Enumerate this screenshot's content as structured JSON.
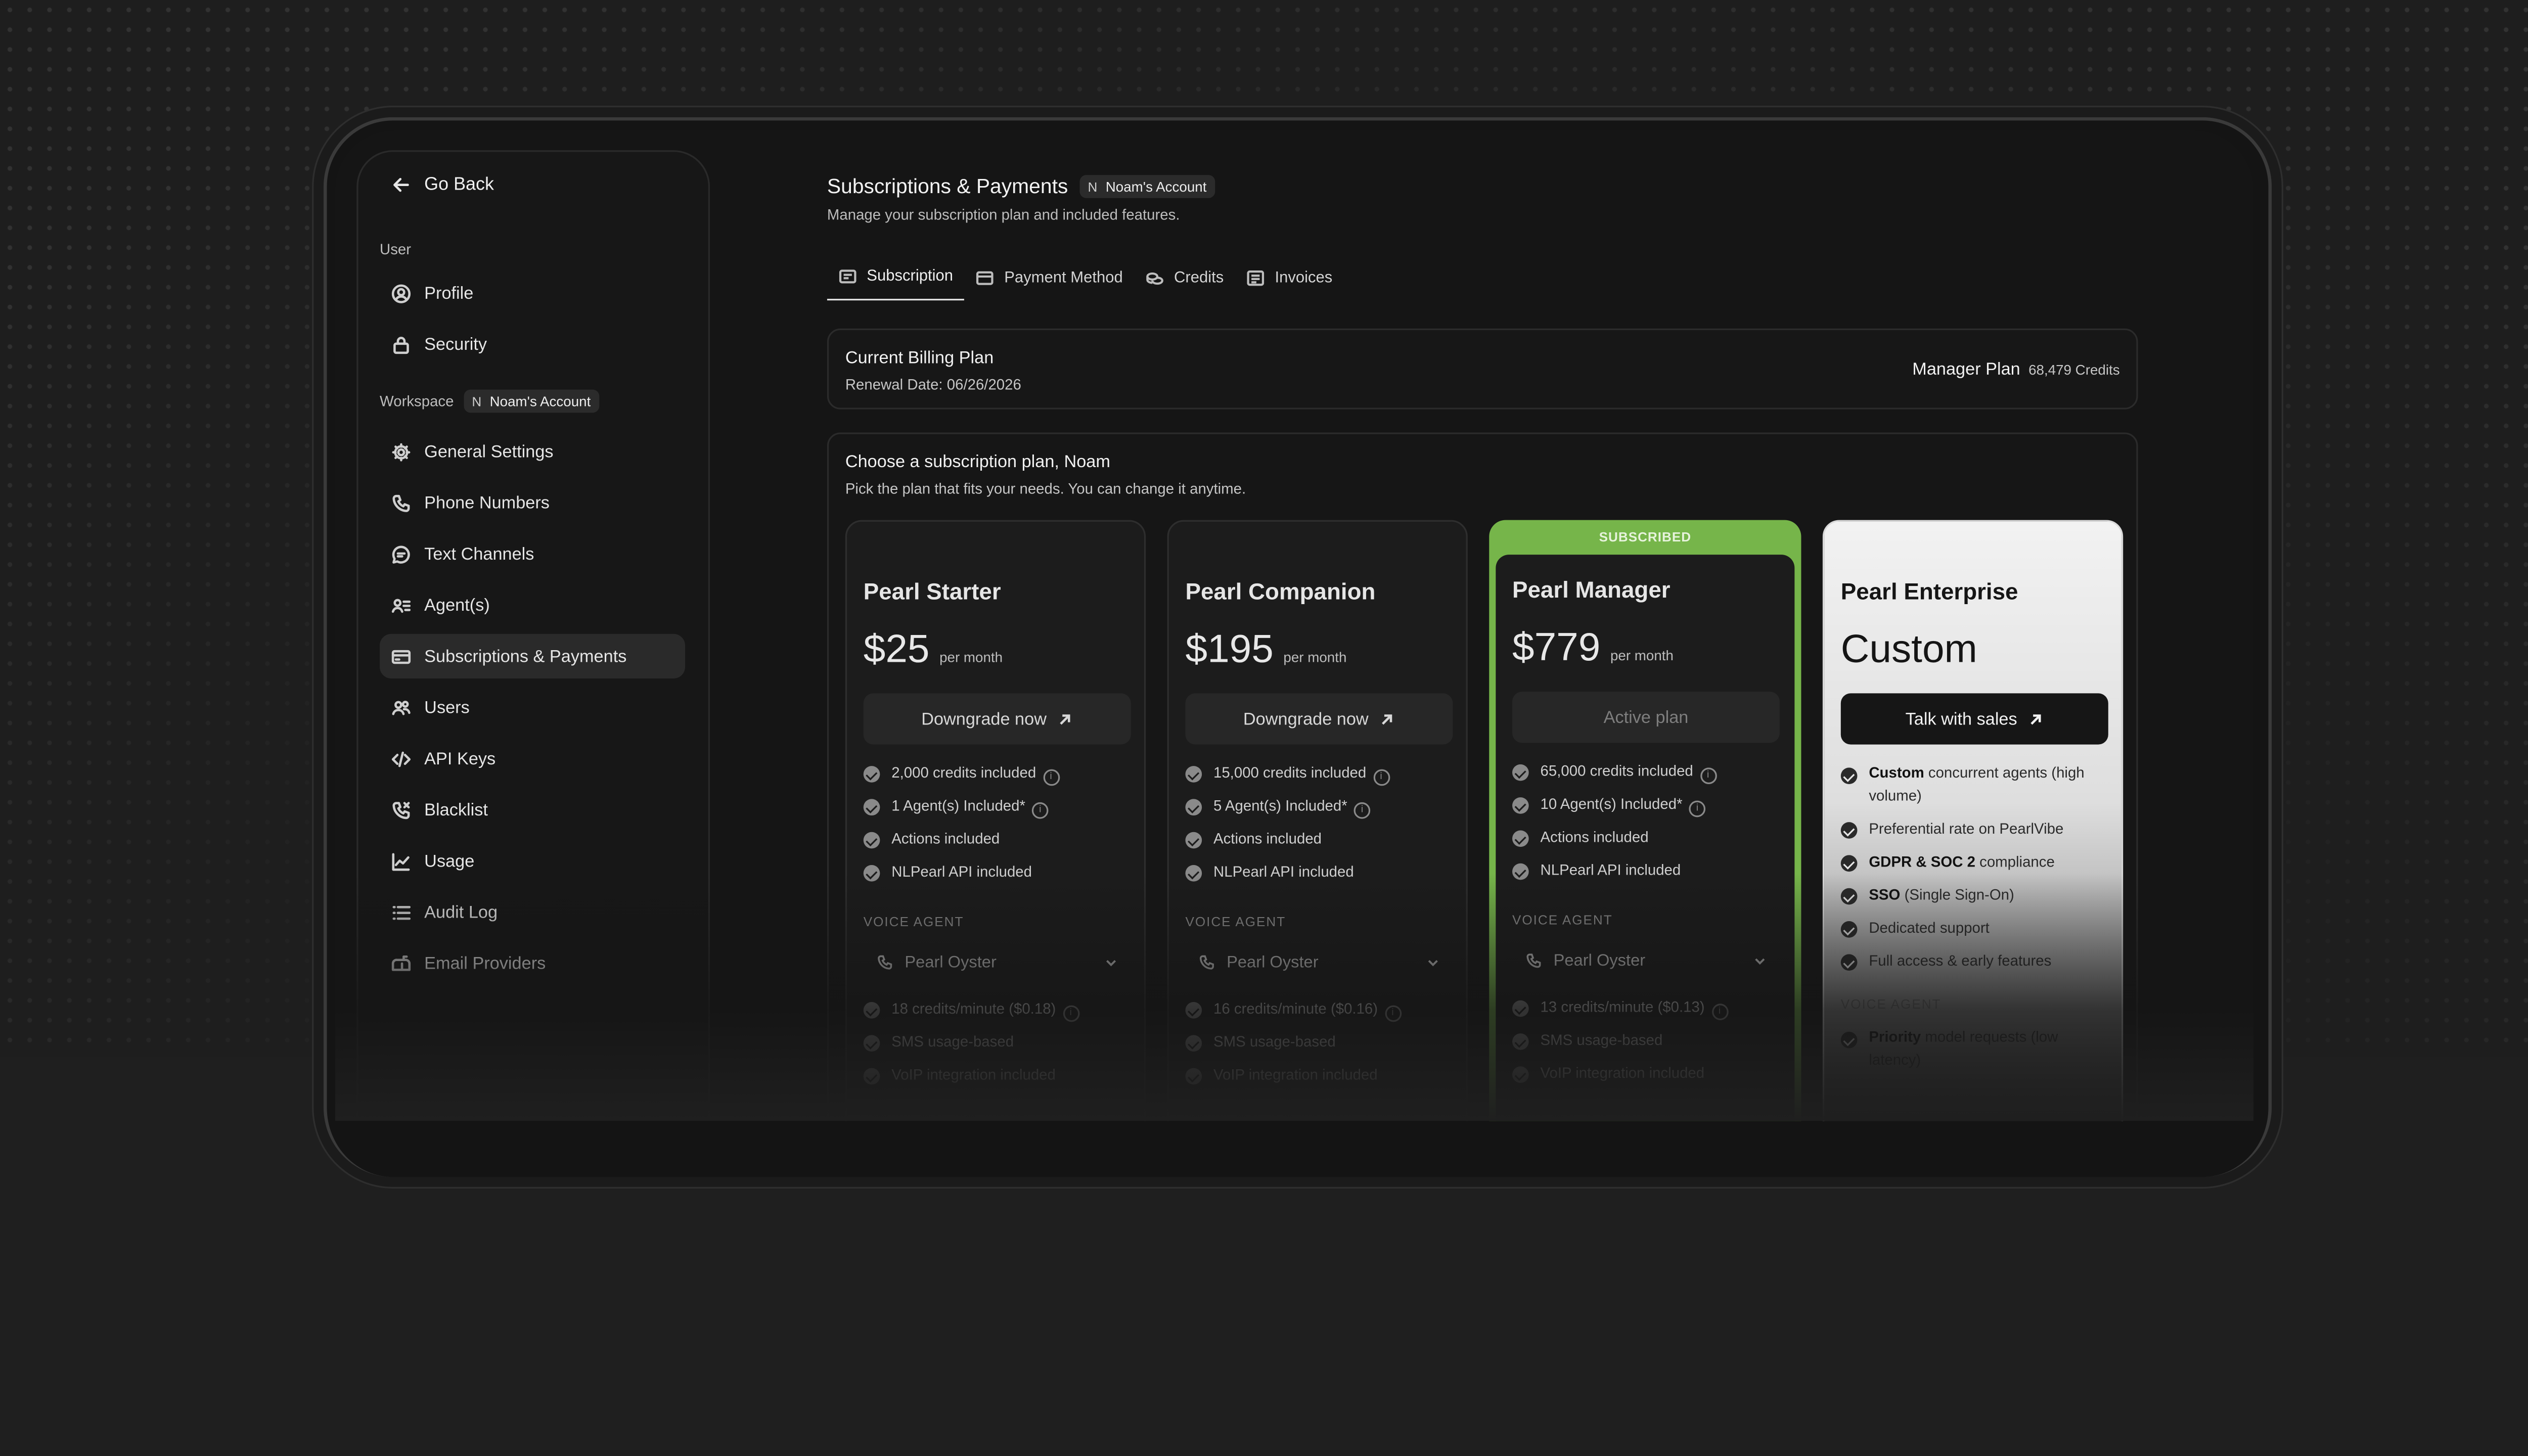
{
  "sidebar": {
    "go_back": "Go Back",
    "user_label": "User",
    "workspace_label": "Workspace",
    "workspace_badge": {
      "initial": "N",
      "name": "Noam's Account"
    },
    "items": [
      {
        "label": "Profile",
        "icon": "user-circle-icon"
      },
      {
        "label": "Security",
        "icon": "lock-icon"
      },
      {
        "label": "General Settings",
        "icon": "gear-icon"
      },
      {
        "label": "Phone Numbers",
        "icon": "phone-icon"
      },
      {
        "label": "Text Channels",
        "icon": "chat-bubble-icon"
      },
      {
        "label": "Agent(s)",
        "icon": "agent-list-icon"
      },
      {
        "label": "Subscriptions & Payments",
        "icon": "credit-card-icon",
        "active": true
      },
      {
        "label": "Users",
        "icon": "users-icon"
      },
      {
        "label": "API Keys",
        "icon": "code-icon"
      },
      {
        "label": "Blacklist",
        "icon": "phone-blocked-icon"
      },
      {
        "label": "Usage",
        "icon": "chart-line-icon"
      },
      {
        "label": "Audit Log",
        "icon": "list-icon"
      },
      {
        "label": "Email Providers",
        "icon": "mailbox-icon"
      }
    ]
  },
  "header": {
    "title": "Subscriptions & Payments",
    "badge": {
      "initial": "N",
      "name": "Noam's Account"
    },
    "subtitle": "Manage your subscription plan and included features."
  },
  "tabs": [
    {
      "label": "Subscription",
      "icon": "receipt-icon",
      "active": true
    },
    {
      "label": "Payment Method",
      "icon": "card-icon"
    },
    {
      "label": "Credits",
      "icon": "coins-icon"
    },
    {
      "label": "Invoices",
      "icon": "invoice-list-icon"
    }
  ],
  "billing": {
    "heading": "Current Billing Plan",
    "renewal": "Renewal Date: 06/26/2026",
    "plan": "Manager Plan",
    "credits": "68,479 Credits"
  },
  "choose": {
    "heading": "Choose a subscription plan, Noam",
    "description": "Pick the plan that fits your needs. You can change it anytime."
  },
  "plans": [
    {
      "name": "Pearl Starter",
      "price": "$25",
      "period": "per month",
      "button": "Downgrade now",
      "features": [
        "2,000 credits included",
        "1 Agent(s) Included*",
        "Actions included",
        "NLPearl API included"
      ],
      "voice_label": "VOICE AGENT",
      "voice_agent": "Pearl Oyster",
      "extras": [
        "18 credits/minute ($0.18)",
        "SMS usage-based",
        "VoIP integration included"
      ]
    },
    {
      "name": "Pearl Companion",
      "price": "$195",
      "period": "per month",
      "button": "Downgrade now",
      "features": [
        "15,000 credits included",
        "5 Agent(s) Included*",
        "Actions included",
        "NLPearl API included"
      ],
      "voice_label": "VOICE AGENT",
      "voice_agent": "Pearl Oyster",
      "extras": [
        "16 credits/minute ($0.16)",
        "SMS usage-based",
        "VoIP integration included"
      ]
    },
    {
      "name": "Pearl Manager",
      "price": "$779",
      "period": "per month",
      "button": "Active plan",
      "tag": "SUBSCRIBED",
      "features": [
        "65,000 credits included",
        "10 Agent(s) Included*",
        "Actions included",
        "NLPearl API included"
      ],
      "voice_label": "VOICE AGENT",
      "voice_agent": "Pearl Oyster",
      "extras": [
        "13 credits/minute ($0.13)",
        "SMS usage-based",
        "VoIP integration included"
      ]
    },
    {
      "name": "Pearl Enterprise",
      "price": "Custom",
      "button": "Talk with sales",
      "features": [
        {
          "bold": "Custom",
          "rest": " concurrent agents (high volume)"
        },
        {
          "bold": "",
          "rest": "Preferential rate on PearlVibe"
        },
        {
          "bold": "GDPR & SOC 2",
          "rest": " compliance"
        },
        {
          "bold": "SSO",
          "rest": " (Single Sign-On)"
        },
        {
          "bold": "",
          "rest": "Dedicated support"
        },
        {
          "bold": "",
          "rest": "Full access & early features"
        }
      ],
      "voice_label": "VOICE AGENT",
      "extras": [
        {
          "bold": "Priority",
          "rest": " model requests (low latency)"
        }
      ]
    }
  ],
  "colors": {
    "accent_green": "#76b54a",
    "background": "#1e1e1e",
    "card": "#1c1c1c"
  }
}
